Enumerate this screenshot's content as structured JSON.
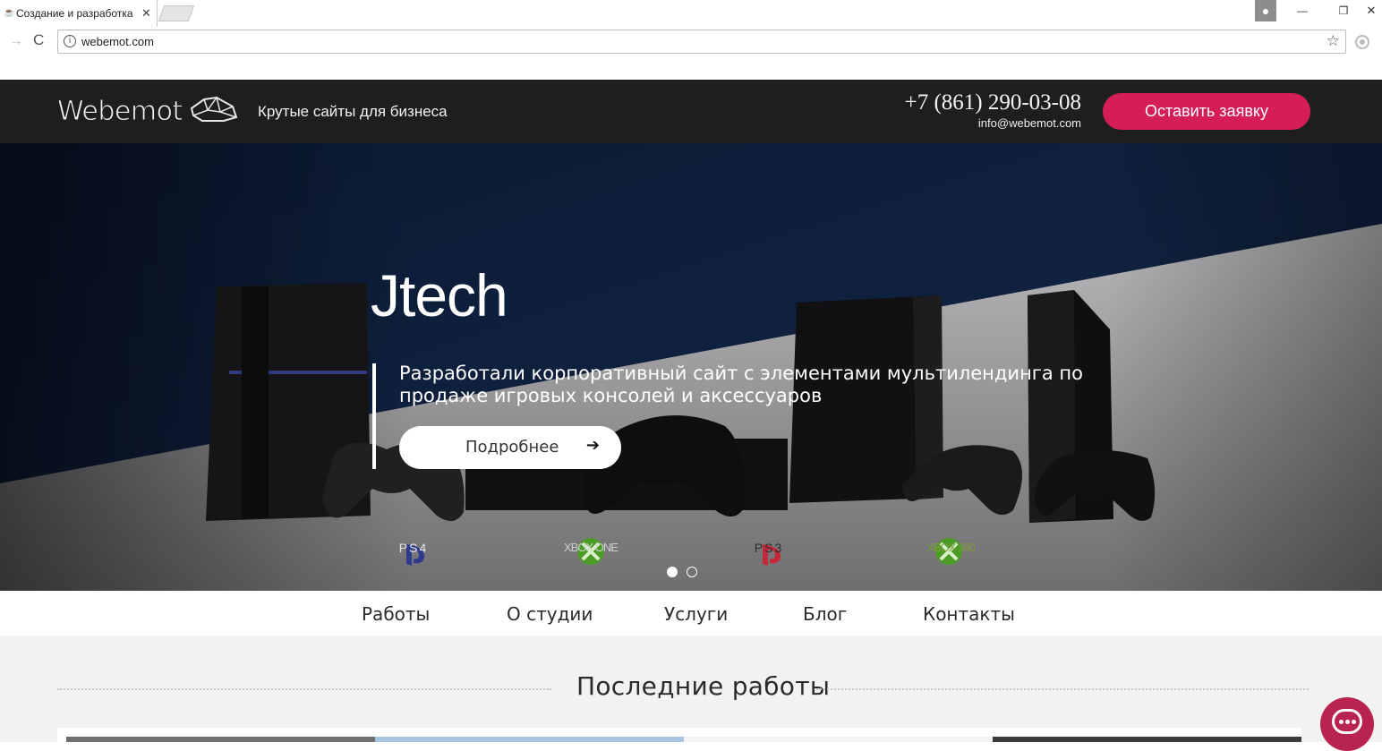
{
  "browser": {
    "tab_title": "Создание и разработка",
    "tab_close": "✕",
    "url": "webemot.com",
    "nav_forward": "→",
    "nav_reload": "C",
    "star": "☆",
    "minimize": "—",
    "restore": "❐",
    "close": "✕"
  },
  "header": {
    "logo_text": "Webemot",
    "tagline": "Крутые сайты для бизнеса",
    "phone": "+7 (861) 290-03-08",
    "email": "info@webemot.com",
    "cta_label": "Оставить заявку"
  },
  "hero": {
    "title": "Jtech",
    "description": "Разработали корпоративный сайт с элементами мультилендинга по продаже игровых консолей и аксессуаров",
    "more_label": "Подробнее",
    "more_arrow": "➔",
    "brands": [
      "PS4",
      "XBOX ONE",
      "PS3",
      "XBOX 360"
    ],
    "slides": 2,
    "active_slide": 0
  },
  "nav": {
    "items": [
      "Работы",
      "О студии",
      "Услуги",
      "Блог",
      "Контакты"
    ]
  },
  "works": {
    "title": "Последние работы"
  },
  "colors": {
    "header_bg": "#1e1e1f",
    "accent": "#d51d58",
    "hero_navy": "#0f1f3a",
    "hero_grey": "#a9a9ab",
    "chat_fab": "#b8234f"
  },
  "icons": {
    "chat": "chat-bubble-icon",
    "info": "info-icon",
    "star": "star-icon"
  }
}
